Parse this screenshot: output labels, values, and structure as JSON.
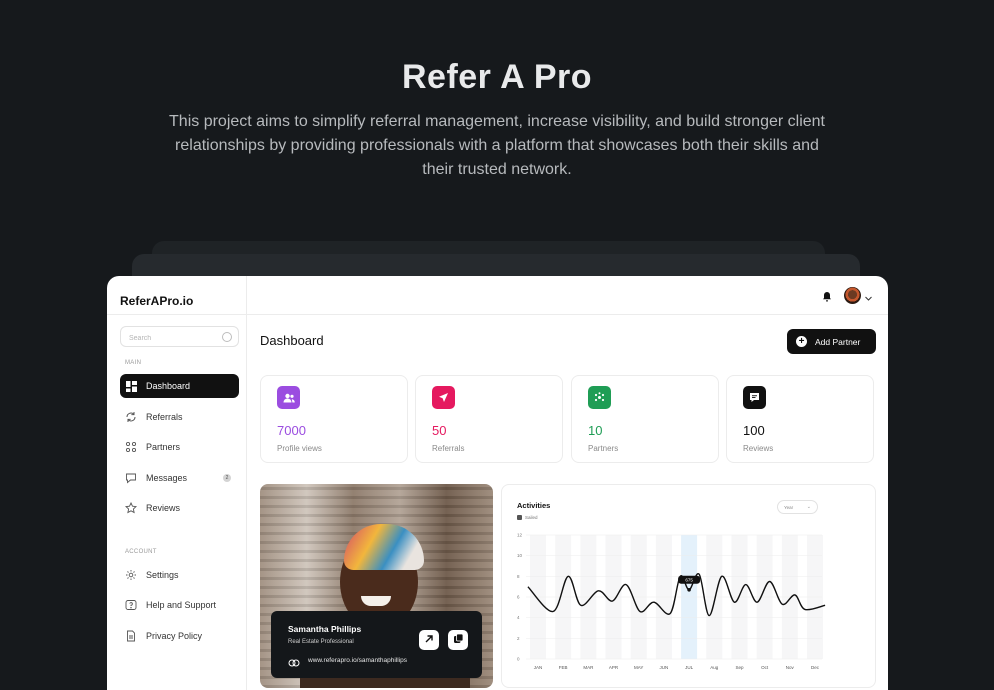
{
  "hero": {
    "title": "Refer A Pro",
    "description": "This project aims to simplify referral management, increase visibility, and build stronger client relationships by providing professionals with a platform that showcases both their skills and their trusted network."
  },
  "app": {
    "brand": "ReferAPro.io",
    "search_placeholder": "Search",
    "sections": {
      "main": "MAIN",
      "account": "ACCOUNT"
    },
    "nav_main": [
      {
        "label": "Dashboard",
        "icon": "grid-icon",
        "active": true
      },
      {
        "label": "Referrals",
        "icon": "refresh-icon"
      },
      {
        "label": "Partners",
        "icon": "partners-icon"
      },
      {
        "label": "Messages",
        "icon": "chat-icon",
        "badge": "2"
      },
      {
        "label": "Reviews",
        "icon": "star-icon"
      }
    ],
    "nav_account": [
      {
        "label": "Settings",
        "icon": "gear-icon"
      },
      {
        "label": "Help and Support",
        "icon": "help-icon"
      },
      {
        "label": "Privacy Policy",
        "icon": "document-icon"
      }
    ],
    "page_title": "Dashboard",
    "add_partner_label": "Add Partner",
    "stats": [
      {
        "value": "7000",
        "label": "Profile views",
        "color": "#9b4de0",
        "icon": "users-icon"
      },
      {
        "value": "50",
        "label": "Referrals",
        "color": "#e5195f",
        "icon": "send-icon"
      },
      {
        "value": "10",
        "label": "Partners",
        "color": "#1f9d55",
        "icon": "network-icon"
      },
      {
        "value": "100",
        "label": "Reviews",
        "color": "#111111",
        "icon": "message-icon"
      }
    ],
    "profile": {
      "name": "Samantha Phillips",
      "role": "Real Estate Professional",
      "url": "www.referapro.io/samanthaphillips"
    }
  },
  "chart_data": {
    "type": "line",
    "title": "Activities",
    "legend": [
      "Sailed"
    ],
    "period_select": "Year",
    "categories": [
      "JAN",
      "FEB",
      "MAR",
      "APR",
      "MAY",
      "JUN",
      "JUL",
      "Aug",
      "Sep",
      "Oct",
      "Nov",
      "Dec"
    ],
    "ylim": [
      0,
      12
    ],
    "yticks": [
      0,
      2,
      4,
      6,
      8,
      10,
      12
    ],
    "grid": true,
    "highlight": {
      "category": "JUL",
      "label": "675"
    },
    "series": [
      {
        "name": "Sailed",
        "x": [
          -0.4,
          0.6,
          1.2,
          1.7,
          2.4,
          2.95,
          3.5,
          4.05,
          4.6,
          5.25,
          5.65,
          6.0,
          6.4,
          6.8,
          7.3,
          7.8,
          8.25,
          8.7,
          9.2,
          9.7,
          10.2,
          10.6,
          11.4
        ],
        "y": [
          7,
          4.6,
          8,
          5.2,
          6.6,
          5.6,
          7.2,
          4.6,
          5.5,
          4.4,
          8,
          6.7,
          8.2,
          4.2,
          8,
          5.5,
          7.2,
          5.5,
          7.5,
          5.3,
          6.2,
          4.8,
          5.2
        ]
      }
    ]
  }
}
